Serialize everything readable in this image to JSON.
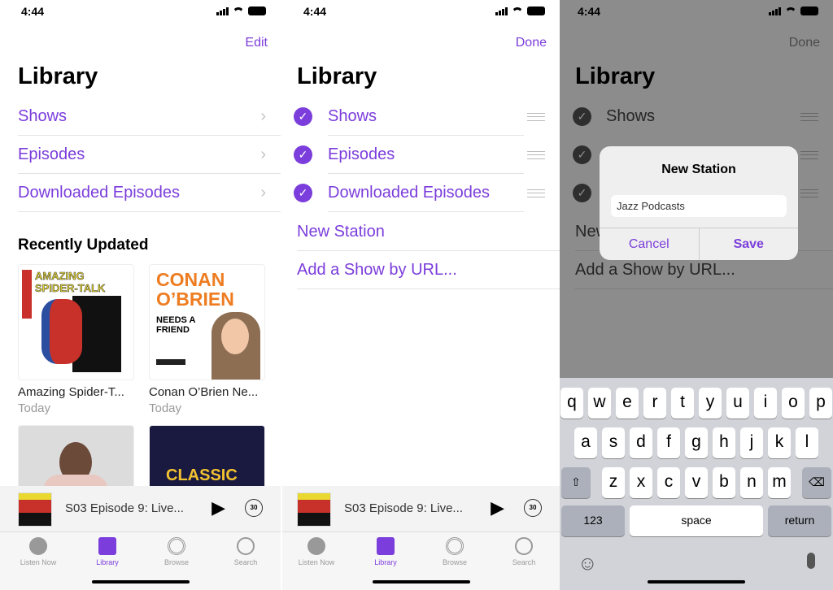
{
  "status": {
    "time": "4:44"
  },
  "accent": "#7b3ddb",
  "library_title": "Library",
  "library_items": [
    "Shows",
    "Episodes",
    "Downloaded Episodes"
  ],
  "extra_items": [
    "New Station",
    "Add a Show by URL..."
  ],
  "screen1": {
    "nav_button": "Edit",
    "section_title": "Recently Updated",
    "shows": [
      {
        "title": "Amazing Spider-T...",
        "subtitle": "Today",
        "art_text": "AMAZING SPIDER-TALK"
      },
      {
        "title": "Conan O’Brien Ne...",
        "subtitle": "Today",
        "art_text": "CONAN O’BRIEN NEEDS A FRIEND"
      }
    ],
    "art_row2_text": "CLASSIC"
  },
  "screen2": {
    "nav_button": "Done"
  },
  "screen3": {
    "nav_button": "Done",
    "dialog": {
      "title": "New Station",
      "input_value": "Jazz Podcasts",
      "cancel": "Cancel",
      "save": "Save"
    },
    "keyboard": {
      "row1": [
        "q",
        "w",
        "e",
        "r",
        "t",
        "y",
        "u",
        "i",
        "o",
        "p"
      ],
      "row2": [
        "a",
        "s",
        "d",
        "f",
        "g",
        "h",
        "j",
        "k",
        "l"
      ],
      "row3": [
        "z",
        "x",
        "c",
        "v",
        "b",
        "n",
        "m"
      ],
      "numbers": "123",
      "space": "space",
      "return": "return"
    }
  },
  "mini_player": {
    "episode": "S03 Episode 9: Live...",
    "skip": "30"
  },
  "tabs": [
    "Listen Now",
    "Library",
    "Browse",
    "Search"
  ]
}
